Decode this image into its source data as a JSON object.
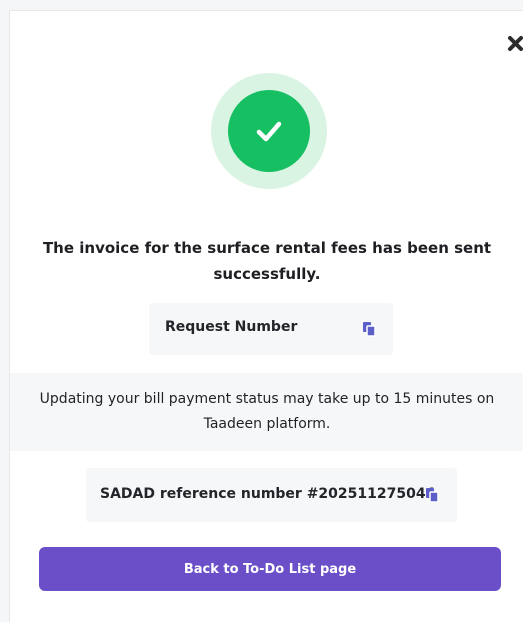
{
  "modal": {
    "close_icon": "close-icon",
    "success_icon": "check-icon",
    "message": "The invoice for the surface rental fees has been sent successfully.",
    "request": {
      "label": "Request Number",
      "icon": "copy-icon"
    },
    "notice": "Updating your bill payment status may take up to 15 minutes on Taadeen platform.",
    "sadad": {
      "text": "SADAD reference number #202511275044",
      "icon": "copy-icon"
    },
    "back_button_label": "Back to To-Do List page"
  },
  "colors": {
    "success_green": "#17bf63",
    "success_ring": "#d9f4e3",
    "accent_purple": "#6a4fc8",
    "copy_icon": "#5b5fc7"
  }
}
